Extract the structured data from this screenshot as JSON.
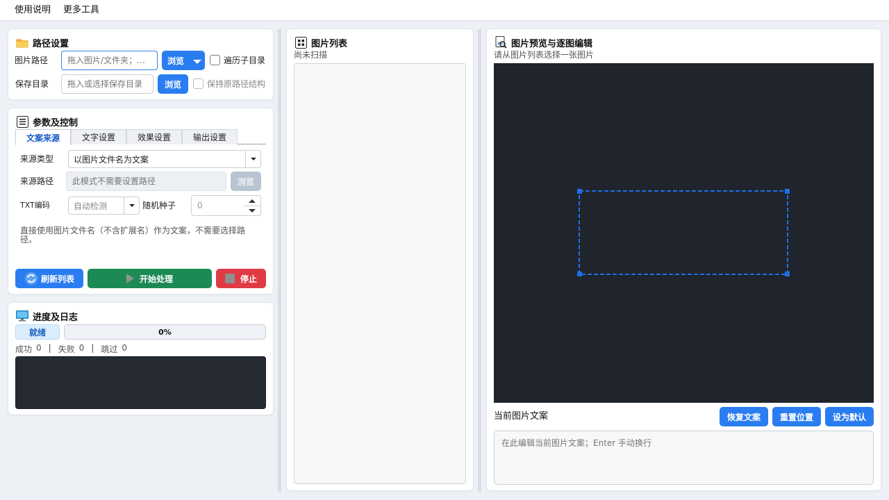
{
  "menubar": {
    "items": [
      "使用说明",
      "更多工具"
    ]
  },
  "path_settings": {
    "title": "路径设置",
    "image_path_label": "图片路径",
    "image_path_placeholder": "拖入图片/文件夹；…",
    "browse_label": "浏览",
    "traverse_subdirs_label": "遍历子目录",
    "save_dir_label": "保存目录",
    "save_dir_placeholder": "拖入或选择保存目录",
    "save_browse_label": "浏览",
    "keep_structure_label": "保持原路径结构"
  },
  "params": {
    "title": "参数及控制",
    "tabs": [
      "文案来源",
      "文字设置",
      "效果设置",
      "输出设置"
    ],
    "source_type_label": "来源类型",
    "source_type_value": "以图片文件名为文案",
    "source_path_label": "来源路径",
    "source_path_placeholder": "此模式不需要设置路径",
    "source_browse_label": "浏览",
    "txt_encoding_label": "TXT编码",
    "txt_encoding_value": "自动检测",
    "random_seed_label": "随机种子",
    "random_seed_value": "0",
    "hint": "直接使用图片文件名（不含扩展名）作为文案，不需要选择路径。",
    "refresh_label": "刷新列表",
    "start_label": "开始处理",
    "stop_label": "停止"
  },
  "progress": {
    "title": "进度及日志",
    "status": "就绪",
    "value": 0,
    "percent_text": "0%",
    "success_label": "成功",
    "success_count": "0",
    "fail_label": "失败",
    "fail_count": "0",
    "skip_label": "跳过",
    "skip_count": "0",
    "sep": "|"
  },
  "image_list": {
    "title": "图片列表",
    "status": "尚未扫描"
  },
  "preview": {
    "title": "图片预览与逐图编辑",
    "hint": "请从图片列表选择一张图片",
    "current_text_label": "当前图片文案",
    "restore_label": "恢复文案",
    "reset_pos_label": "重置位置",
    "set_default_label": "设为默认",
    "text_placeholder": "在此编辑当前图片文案；Enter 手动换行"
  },
  "colors": {
    "accent": "#2a7df0",
    "start": "#1d8a55",
    "stop": "#df3b45",
    "preview_bg": "#20242c",
    "selection": "#1e6fe6"
  }
}
